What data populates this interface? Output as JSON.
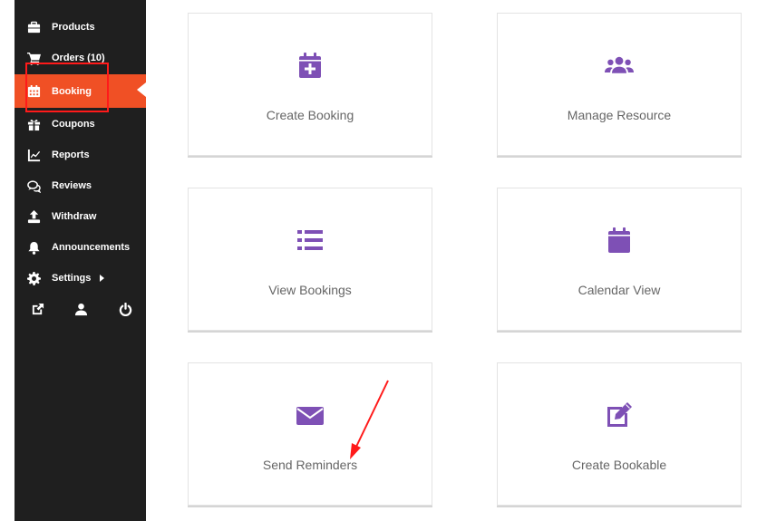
{
  "sidebar": {
    "items": [
      {
        "label": "Products",
        "icon": "briefcase-icon"
      },
      {
        "label": "Orders (10)",
        "icon": "cart-icon"
      },
      {
        "label": "Booking",
        "icon": "calendar-icon",
        "active": true
      },
      {
        "label": "Coupons",
        "icon": "gift-icon"
      },
      {
        "label": "Reports",
        "icon": "chart-icon"
      },
      {
        "label": "Reviews",
        "icon": "comments-icon"
      },
      {
        "label": "Withdraw",
        "icon": "upload-icon"
      },
      {
        "label": "Announcements",
        "icon": "bell-icon"
      },
      {
        "label": "Settings",
        "icon": "gear-icon"
      }
    ],
    "bottom_icons": [
      "external-link-icon",
      "user-icon",
      "power-icon"
    ]
  },
  "cards": [
    {
      "label": "Create Booking",
      "icon": "calendar-plus-icon"
    },
    {
      "label": "Manage Resource",
      "icon": "users-icon"
    },
    {
      "label": "View Bookings",
      "icon": "list-icon"
    },
    {
      "label": "Calendar View",
      "icon": "calendar-icon"
    },
    {
      "label": "Send Reminders",
      "icon": "envelope-icon"
    },
    {
      "label": "Create Bookable",
      "icon": "edit-icon"
    }
  ],
  "colors": {
    "sidebar_bg": "#1f1f1f",
    "active_bg": "#f05025",
    "icon_purple": "#7e50b5",
    "annotation_red": "#ff1a1a"
  }
}
